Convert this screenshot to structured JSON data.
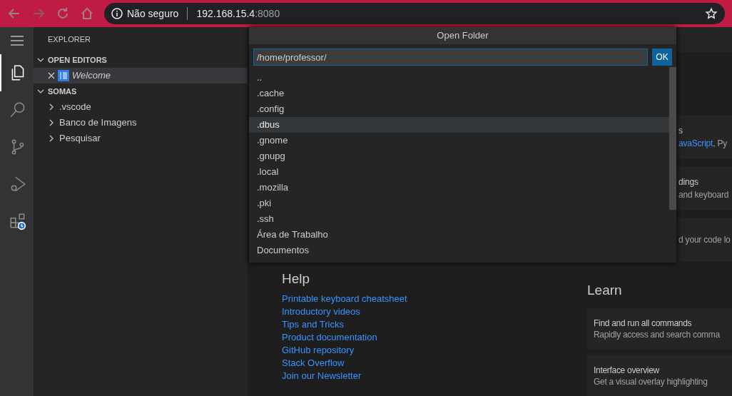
{
  "browser": {
    "security": "Não seguro",
    "host": "192.168.15.4",
    "port": ":8080"
  },
  "activity_bar": [
    {
      "kind": "files",
      "selected": true
    },
    {
      "kind": "search",
      "selected": false
    },
    {
      "kind": "scm",
      "selected": false
    },
    {
      "kind": "debug",
      "selected": false
    },
    {
      "kind": "extensions",
      "selected": false
    }
  ],
  "sidebar": {
    "title": "EXPLORER",
    "sections": [
      {
        "title": "OPEN EDITORS",
        "expanded": true,
        "editors": [
          {
            "name": "Welcome",
            "selected": true
          }
        ]
      },
      {
        "title": "SOMAS",
        "expanded": true,
        "children": [
          {
            "name": ".vscode",
            "expanded": false
          },
          {
            "name": "Banco de Imagens",
            "expanded": false
          },
          {
            "name": "Pesquisar",
            "expanded": false
          }
        ]
      }
    ]
  },
  "dialog": {
    "title": "Open Folder",
    "path": "/home/professor/",
    "ok": "OK",
    "items": [
      {
        "name": "..",
        "selected": false
      },
      {
        "name": ".cache",
        "selected": false
      },
      {
        "name": ".config",
        "selected": false
      },
      {
        "name": ".dbus",
        "selected": true
      },
      {
        "name": ".gnome",
        "selected": false
      },
      {
        "name": ".gnupg",
        "selected": false
      },
      {
        "name": ".local",
        "selected": false
      },
      {
        "name": ".mozilla",
        "selected": false
      },
      {
        "name": ".pki",
        "selected": false
      },
      {
        "name": ".ssh",
        "selected": false
      },
      {
        "name": "Área de Trabalho",
        "selected": false
      },
      {
        "name": "Documentos",
        "selected": false
      }
    ]
  },
  "welcome": {
    "partial_cards": [
      {
        "title": "s",
        "description": [
          {
            "text": "avaScript",
            "link": true
          },
          {
            "text": ", Py",
            "link": false
          }
        ]
      },
      {
        "title": "dings",
        "description": [
          {
            "text": "and keyboard",
            "link": false
          }
        ]
      },
      {
        "description": [
          {
            "text": "d your code lo",
            "link": false
          }
        ]
      }
    ],
    "help": {
      "title": "Help",
      "links": [
        "Printable keyboard cheatsheet",
        "Introductory videos",
        "Tips and Tricks",
        "Product documentation",
        "GitHub repository",
        "Stack Overflow",
        "Join our Newsletter"
      ]
    },
    "learn": {
      "title": "Learn",
      "cards": [
        {
          "title": "Find and run all commands",
          "description": "Rapidly access and search comma"
        },
        {
          "title": "Interface overview",
          "description": "Get a visual overlay highlighting"
        }
      ]
    }
  }
}
